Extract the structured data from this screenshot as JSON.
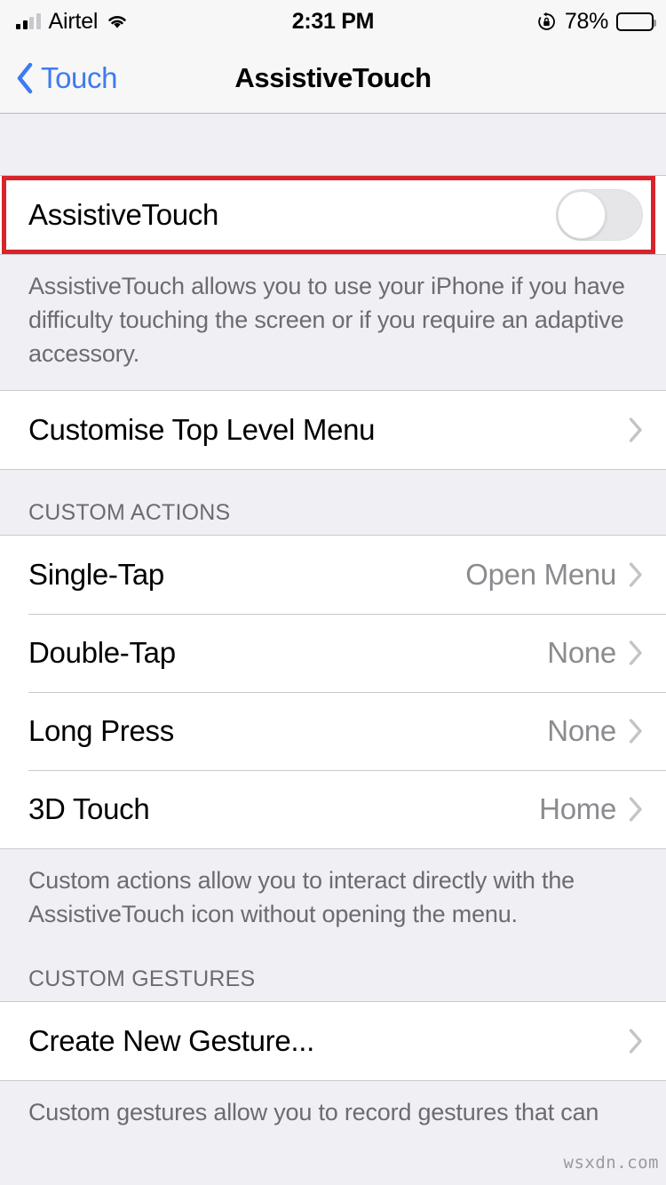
{
  "status_bar": {
    "carrier": "Airtel",
    "signal_bars_filled": 2,
    "signal_bars_total": 4,
    "wifi_icon": "wifi-icon",
    "time": "2:31 PM",
    "rotation_lock_icon": "rotation-lock-icon",
    "battery_percent": "78%",
    "battery_level": 78,
    "battery_icon": "battery-icon"
  },
  "nav_bar": {
    "back_label": "Touch",
    "back_icon": "chevron-left-icon",
    "title": "AssistiveTouch"
  },
  "main_toggle": {
    "label": "AssistiveTouch",
    "state": "off",
    "footer": "AssistiveTouch allows you to use your iPhone if you have difficulty touching the screen or if you require an adaptive accessory."
  },
  "customise_row": {
    "label": "Customise Top Level Menu",
    "chevron_icon": "chevron-right-icon"
  },
  "custom_actions": {
    "header": "CUSTOM ACTIONS",
    "rows": [
      {
        "label": "Single-Tap",
        "value": "Open Menu",
        "chevron_icon": "chevron-right-icon"
      },
      {
        "label": "Double-Tap",
        "value": "None",
        "chevron_icon": "chevron-right-icon"
      },
      {
        "label": "Long Press",
        "value": "None",
        "chevron_icon": "chevron-right-icon"
      },
      {
        "label": "3D Touch",
        "value": "Home",
        "chevron_icon": "chevron-right-icon"
      }
    ],
    "footer": "Custom actions allow you to interact directly with the AssistiveTouch icon without opening the menu."
  },
  "custom_gestures": {
    "header": "CUSTOM GESTURES",
    "rows": [
      {
        "label": "Create New Gesture...",
        "chevron_icon": "chevron-right-icon"
      }
    ],
    "footer": "Custom gestures allow you to record gestures that can"
  },
  "annotation": {
    "highlight_color": "#d8232a"
  },
  "watermark": {
    "text": "wsxdn.com"
  },
  "colors": {
    "accent_blue": "#3d7bf0",
    "group_bg": "#ffffff",
    "page_bg": "#efeff4",
    "secondary_text": "#6c6c70",
    "value_text": "#8b8b90",
    "separator": "#c9c9cb"
  }
}
